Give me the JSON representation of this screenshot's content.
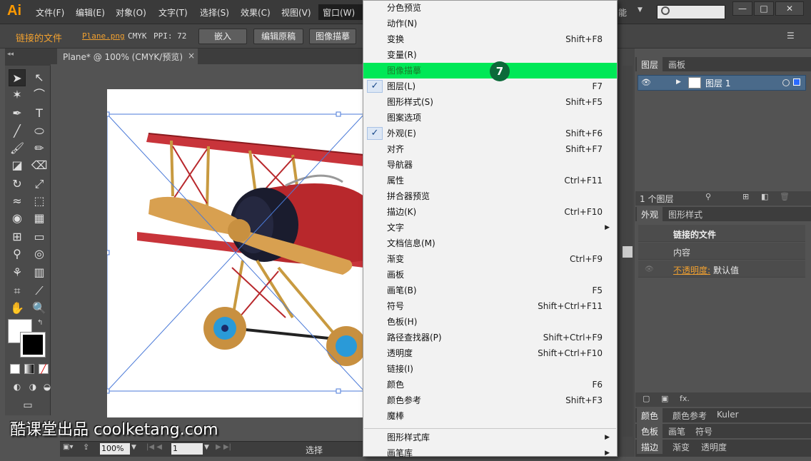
{
  "app": {
    "logo": "Ai"
  },
  "menubar": {
    "items": [
      "文件(F)",
      "编辑(E)",
      "对象(O)",
      "文字(T)",
      "选择(S)",
      "效果(C)",
      "视图(V)"
    ],
    "window_menu": "窗口(W)",
    "right_fragment": "能",
    "window_controls": {
      "minimize": "—",
      "maximize": "□",
      "close": "✕"
    }
  },
  "control_bar": {
    "linked_file": "链接的文件",
    "file_name": "Plane.png",
    "color_mode": "CMYK",
    "ppi": "PPI: 72",
    "embed": "嵌入",
    "edit_original": "编辑原稿",
    "image_trace": "图像描摹"
  },
  "document_tab": {
    "title": "Plane* @ 100% (CMYK/预览)",
    "close": "×"
  },
  "status_bar": {
    "zoom": "100%",
    "page": "1",
    "status": "选择"
  },
  "watermark": "酷课堂出品 coolketang.com",
  "window_menu_items": [
    {
      "label": "分色预览",
      "shortcut": "",
      "checked": false,
      "submenu": false
    },
    {
      "label": "动作(N)",
      "shortcut": "",
      "checked": false,
      "submenu": false
    },
    {
      "label": "变换",
      "shortcut": "Shift+F8",
      "checked": false,
      "submenu": false
    },
    {
      "label": "变量(R)",
      "shortcut": "",
      "checked": false,
      "submenu": false
    },
    {
      "label": "图像描摹",
      "shortcut": "",
      "checked": false,
      "submenu": false,
      "highlighted": true
    },
    {
      "label": "图层(L)",
      "shortcut": "F7",
      "checked": true,
      "submenu": false
    },
    {
      "label": "图形样式(S)",
      "shortcut": "Shift+F5",
      "checked": false,
      "submenu": false
    },
    {
      "label": "图案选项",
      "shortcut": "",
      "checked": false,
      "submenu": false
    },
    {
      "label": "外观(E)",
      "shortcut": "Shift+F6",
      "checked": true,
      "submenu": false
    },
    {
      "label": "对齐",
      "shortcut": "Shift+F7",
      "checked": false,
      "submenu": false
    },
    {
      "label": "导航器",
      "shortcut": "",
      "checked": false,
      "submenu": false
    },
    {
      "label": "属性",
      "shortcut": "Ctrl+F11",
      "checked": false,
      "submenu": false
    },
    {
      "label": "拼合器预览",
      "shortcut": "",
      "checked": false,
      "submenu": false
    },
    {
      "label": "描边(K)",
      "shortcut": "Ctrl+F10",
      "checked": false,
      "submenu": false
    },
    {
      "label": "文字",
      "shortcut": "",
      "checked": false,
      "submenu": true
    },
    {
      "label": "文档信息(M)",
      "shortcut": "",
      "checked": false,
      "submenu": false
    },
    {
      "label": "渐变",
      "shortcut": "Ctrl+F9",
      "checked": false,
      "submenu": false
    },
    {
      "label": "画板",
      "shortcut": "",
      "checked": false,
      "submenu": false
    },
    {
      "label": "画笔(B)",
      "shortcut": "F5",
      "checked": false,
      "submenu": false
    },
    {
      "label": "符号",
      "shortcut": "Shift+Ctrl+F11",
      "checked": false,
      "submenu": false
    },
    {
      "label": "色板(H)",
      "shortcut": "",
      "checked": false,
      "submenu": false
    },
    {
      "label": "路径查找器(P)",
      "shortcut": "Shift+Ctrl+F9",
      "checked": false,
      "submenu": false
    },
    {
      "label": "透明度",
      "shortcut": "Shift+Ctrl+F10",
      "checked": false,
      "submenu": false
    },
    {
      "label": "链接(I)",
      "shortcut": "",
      "checked": false,
      "submenu": false
    },
    {
      "label": "颜色",
      "shortcut": "F6",
      "checked": false,
      "submenu": false
    },
    {
      "label": "颜色参考",
      "shortcut": "Shift+F3",
      "checked": false,
      "submenu": false
    },
    {
      "label": "魔棒",
      "shortcut": "",
      "checked": false,
      "submenu": false
    }
  ],
  "window_menu_items_after_sep": [
    {
      "label": "图形样式库",
      "submenu": true
    },
    {
      "label": "画笔库",
      "submenu": true
    }
  ],
  "step_badge": "7",
  "layers_panel": {
    "tabs": [
      "图层",
      "画板"
    ],
    "layer_name": "图层 1",
    "count": "1 个图层"
  },
  "appearance_panel": {
    "tabs": [
      "外观",
      "图形样式"
    ],
    "title": "链接的文件",
    "content": "内容",
    "opacity_label": "不透明度:",
    "opacity_value": "默认值"
  },
  "bottom_panels": {
    "row1": [
      "颜色",
      "颜色参考",
      "Kuler"
    ],
    "row2": [
      "色板",
      "画笔",
      "符号"
    ],
    "row3": [
      "描边",
      "渐变",
      "透明度"
    ]
  },
  "colors": {
    "highlight": "#00e857",
    "accent_orange": "#f0a030",
    "badge": "#0c6a3a"
  }
}
